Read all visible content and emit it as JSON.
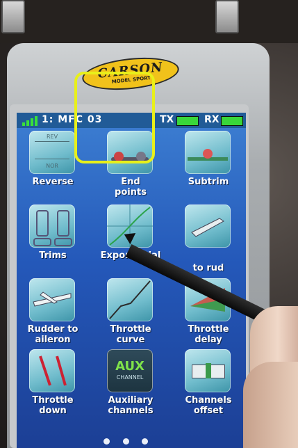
{
  "device": {
    "brand_logo": "CARSON",
    "brand_sub": "MODEL SPORT"
  },
  "status_bar": {
    "model": "1: MFC 03",
    "tx_label": "TX",
    "rx_label": "RX",
    "tx_battery_level": 1.0,
    "rx_battery_level": 1.0,
    "colors": {
      "bar": "#215b97",
      "battery": "#39d63a",
      "signal": "#39e13a"
    }
  },
  "menu": {
    "items": [
      {
        "label": "Reverse",
        "icon": "reverse-icon"
      },
      {
        "label": "End\npoints",
        "icon": "end-points-icon"
      },
      {
        "label": "Subtrim",
        "icon": "subtrim-icon"
      },
      {
        "label": "Trims",
        "icon": "trims-icon"
      },
      {
        "label": "Exponential",
        "icon": "exponential-icon",
        "selected": true
      },
      {
        "label": "to rud",
        "icon": "mix-to-rudder-icon"
      },
      {
        "label": "Rudder to\naileron",
        "icon": "rudder-to-aileron-icon"
      },
      {
        "label": "Throttle\ncurve",
        "icon": "throttle-curve-icon"
      },
      {
        "label": "Throttle\ndelay",
        "icon": "throttle-delay-icon"
      },
      {
        "label": "Throttle\ndown",
        "icon": "throttle-down-icon"
      },
      {
        "label": "Auxiliary\nchannels",
        "icon": "auxiliary-channels-icon"
      },
      {
        "label": "Channels\noffset",
        "icon": "channels-offset-icon"
      }
    ],
    "icon_text": {
      "reverse_top": "REV",
      "reverse_bottom": "NOR",
      "aux_main": "AUX",
      "aux_sub": "CHANNEL"
    },
    "highlight_color": "#e8f01a"
  },
  "pagination": {
    "pages": 3,
    "current": 1
  }
}
